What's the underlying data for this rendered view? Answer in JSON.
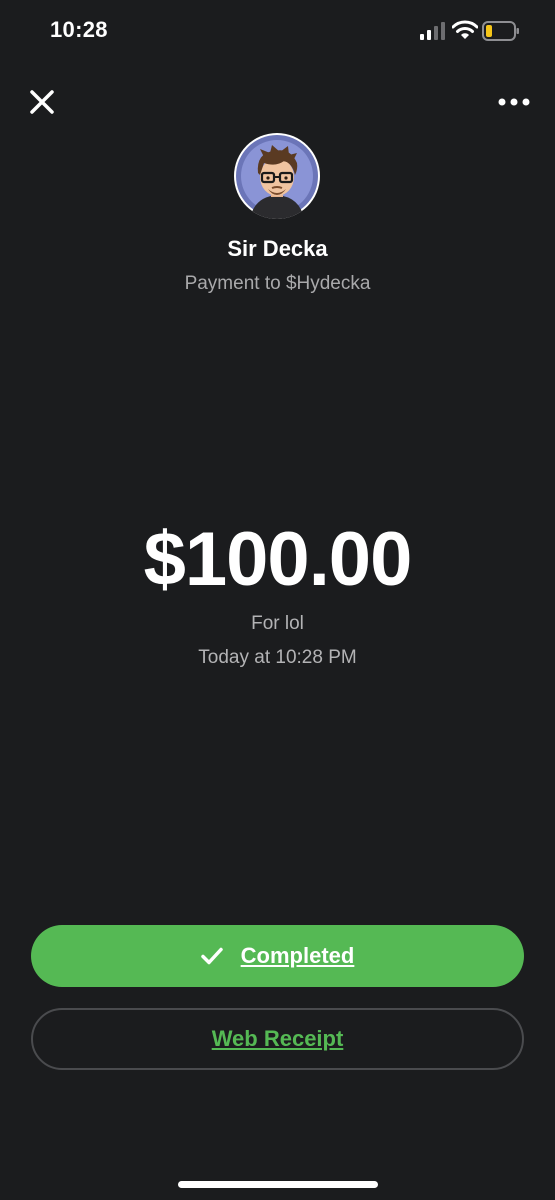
{
  "status_bar": {
    "time": "10:28",
    "icons": [
      "signal-icon",
      "wifi-icon",
      "battery-icon"
    ],
    "battery_color": "#f5c518"
  },
  "header": {
    "close_icon": "close-icon",
    "more_icon": "more-icon"
  },
  "contact": {
    "avatar": "avatar",
    "name": "Sir Decka",
    "subtitle": "Payment to $Hydecka"
  },
  "payment": {
    "amount": "$100.00",
    "note": "For lol",
    "timestamp": "Today at 10:28 PM"
  },
  "actions": {
    "completed_label": "Completed",
    "completed_icon": "check-icon",
    "receipt_label": "Web Receipt"
  },
  "colors": {
    "background": "#1b1c1e",
    "accent_green": "#55b954",
    "muted_text": "#a9a9ab"
  }
}
